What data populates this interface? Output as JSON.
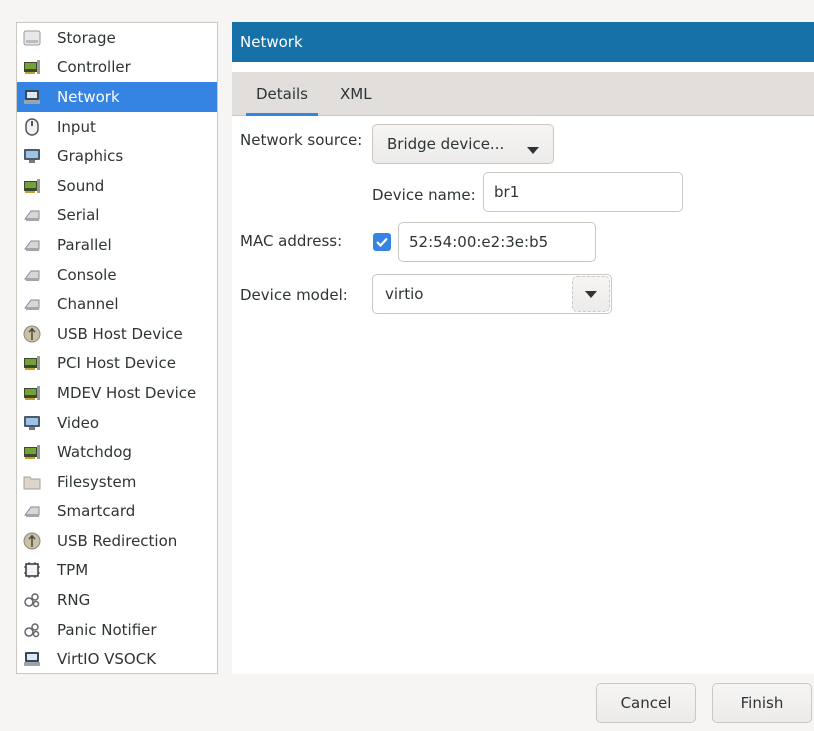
{
  "sidebar": {
    "items": [
      {
        "label": "Storage",
        "icon": "disk-icon"
      },
      {
        "label": "Controller",
        "icon": "controller-card-icon"
      },
      {
        "label": "Network",
        "icon": "network-icon"
      },
      {
        "label": "Input",
        "icon": "mouse-icon"
      },
      {
        "label": "Graphics",
        "icon": "monitor-icon"
      },
      {
        "label": "Sound",
        "icon": "sound-card-icon"
      },
      {
        "label": "Serial",
        "icon": "serial-port-icon"
      },
      {
        "label": "Parallel",
        "icon": "parallel-port-icon"
      },
      {
        "label": "Console",
        "icon": "console-icon"
      },
      {
        "label": "Channel",
        "icon": "channel-icon"
      },
      {
        "label": "USB Host Device",
        "icon": "usb-icon"
      },
      {
        "label": "PCI Host Device",
        "icon": "pci-card-icon"
      },
      {
        "label": "MDEV Host Device",
        "icon": "mdev-card-icon"
      },
      {
        "label": "Video",
        "icon": "video-monitor-icon"
      },
      {
        "label": "Watchdog",
        "icon": "watchdog-card-icon"
      },
      {
        "label": "Filesystem",
        "icon": "folder-icon"
      },
      {
        "label": "Smartcard",
        "icon": "smartcard-icon"
      },
      {
        "label": "USB Redirection",
        "icon": "usb-redirection-icon"
      },
      {
        "label": "TPM",
        "icon": "chip-icon"
      },
      {
        "label": "RNG",
        "icon": "dice-icon"
      },
      {
        "label": "Panic Notifier",
        "icon": "panic-icon"
      },
      {
        "label": "VirtIO VSOCK",
        "icon": "vsock-icon"
      }
    ],
    "selected": "Network"
  },
  "header": {
    "title": "Network"
  },
  "tabs": [
    {
      "label": "Details"
    },
    {
      "label": "XML"
    }
  ],
  "form": {
    "network_source_label": "Network source:",
    "network_source_value": "Bridge device...",
    "device_name_label": "Device name:",
    "device_name_value": "br1",
    "mac_label": "MAC address:",
    "mac_checked": true,
    "mac_value": "52:54:00:e2:3e:b5",
    "device_model_label": "Device model:",
    "device_model_value": "virtio"
  },
  "footer": {
    "cancel_label": "Cancel",
    "finish_label": "Finish"
  },
  "colors": {
    "accent": "#3584e4",
    "header_bg": "#1671a8"
  }
}
